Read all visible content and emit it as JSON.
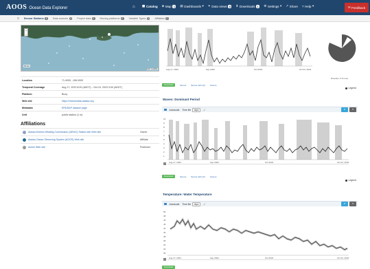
{
  "nav": {
    "logo": "AOOS",
    "app_name": "Ocean Data Explorer",
    "items": [
      {
        "label": "Catalog",
        "badge": "",
        "active": true
      },
      {
        "label": "Map",
        "badge": "1",
        "active": false
      },
      {
        "label": "Dashboards",
        "badge": "",
        "active": false
      },
      {
        "label": "Data views",
        "badge": "8",
        "active": false
      },
      {
        "label": "Downloads",
        "badge": "1",
        "active": false
      },
      {
        "label": "Settings",
        "badge": "",
        "active": false
      },
      {
        "label": "Share",
        "badge": "",
        "active": false
      },
      {
        "label": "Help",
        "badge": "",
        "active": false
      }
    ],
    "feedback": "Feedback"
  },
  "filters": {
    "items": [
      {
        "label": "Sensor Stations",
        "count": "1",
        "active": true
      },
      {
        "label": "Data sources",
        "count": "0",
        "active": false
      },
      {
        "label": "Project data",
        "count": "0",
        "active": false
      },
      {
        "label": "Moving platforms",
        "count": "0",
        "active": false
      },
      {
        "label": "Variable Types",
        "count": "0",
        "active": false
      },
      {
        "label": "Affiliates",
        "count": "0",
        "active": false
      }
    ]
  },
  "map": {
    "scale": "50 km",
    "attribution": "Esri | Leaflet"
  },
  "info": {
    "rows": [
      {
        "key": "Location",
        "value": "71.4009, -156.0000",
        "link": false
      },
      {
        "key": "Temporal Coverage",
        "value": "Aug 17, 2023 8:00 (AKDT) – Oct 24, 2023 9:00 (AKDT)",
        "link": false
      },
      {
        "key": "Platform",
        "value": "Buoy",
        "link": false
      },
      {
        "key": "Web site",
        "value": "https://marinedata-alaska.org",
        "link": true
      },
      {
        "key": "Metadata",
        "value": "ERDDAP dataset page",
        "link": true
      },
      {
        "key": "Unit",
        "value": "public station (1 m)",
        "link": false
      }
    ]
  },
  "affiliations": {
    "title": "Affiliations",
    "rows": [
      {
        "name": "Alaska Eskimo Whaling Commission (AEWC)  Station site  Web site",
        "role": "Owner",
        "color": "#8aa4c0"
      },
      {
        "name": "Alaska Ocean Observing System (AOOS)  Web site",
        "role": "Affiliate",
        "color": "#1e6b8c"
      },
      {
        "name": "Axiom  Web site",
        "role": "Publisher",
        "color": "#999999"
      }
    ]
  },
  "charts": {
    "c1": {
      "title": "",
      "xticks": [
        "Aug 17, 2023",
        "Sep 2023",
        "Oct 2023",
        "Oct 24, 2023"
      ],
      "note": "Direction: 0.5 more"
    },
    "c2": {
      "title": "Waves: Dominant Period",
      "autoscale": "Autoscale",
      "timescale": "Time tile",
      "timescale_value": "days",
      "xticks": [
        "Aug 17, 2023",
        "Sep 2023",
        "Oct 2023",
        "Oct 24, 2023"
      ],
      "yticks": [
        "10",
        "9",
        "8",
        "7",
        "6",
        "5",
        "4",
        "3",
        "2",
        "1"
      ]
    },
    "c3": {
      "title": "Temperature: Water Temperature",
      "autoscale": "Autoscale",
      "timescale": "Time tile",
      "timescale_value": "days",
      "xticks": [
        "Aug 17, 2023",
        "Sep 2023",
        "Oct 2023",
        "Oct 24, 2023"
      ],
      "yticks": [
        "50",
        "48",
        "46",
        "44",
        "42",
        "40",
        "38",
        "36",
        "34",
        "32",
        "30"
      ]
    },
    "download": "Download",
    "sensor": "Sensor",
    "sensor_with_qc": "Sensor with QC",
    "source": "Source",
    "legend": "Legend",
    "time": "Time"
  },
  "colors": {
    "nav_bg": "#20466e",
    "feedback": "#c9302c",
    "gauge": "#555555",
    "download": "#5cb85c",
    "blue_btn": "#3aa6d9"
  }
}
